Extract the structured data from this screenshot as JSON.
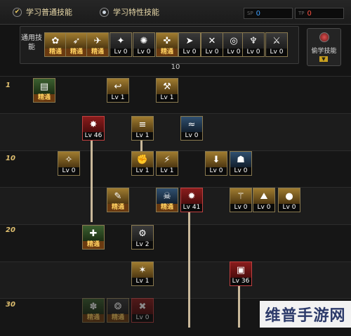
{
  "tabs": {
    "normal": {
      "label": "学习普通技能",
      "checkmark": "✔"
    },
    "special": {
      "label": "学习特性技能"
    }
  },
  "counters": [
    {
      "label": "SP",
      "value": "0",
      "color": "#3fa0ff"
    },
    {
      "label": "TP",
      "value": "0",
      "color": "#ff5040"
    }
  ],
  "common_skills": {
    "label": "通用技能",
    "slots": [
      {
        "icon": "lotus-meditation-icon",
        "lv": "精通",
        "gold": true,
        "glyph": "✿"
      },
      {
        "icon": "rising-strike-icon",
        "lv": "精通",
        "gold": true,
        "glyph": "➶"
      },
      {
        "icon": "leap-kick-icon",
        "lv": "精通",
        "gold": true,
        "glyph": "✈"
      },
      {
        "icon": "wing-icon",
        "lv": "Lv 0",
        "gold": false,
        "glyph": "✦"
      },
      {
        "icon": "sigil-icon",
        "lv": "Lv 0",
        "gold": false,
        "glyph": "✺"
      },
      {
        "icon": "crosshair-icon",
        "lv": "精通",
        "gold": true,
        "glyph": "✜"
      },
      {
        "icon": "dash-icon",
        "lv": "Lv 0",
        "gold": false,
        "glyph": "➤"
      },
      {
        "icon": "fallen-icon",
        "lv": "Lv 0",
        "gold": false,
        "glyph": "✕"
      },
      {
        "icon": "target-icon",
        "lv": "Lv 0",
        "gold": false,
        "glyph": "◎"
      },
      {
        "icon": "buff-icon",
        "lv": "Lv 0",
        "gold": false,
        "glyph": "♆"
      },
      {
        "icon": "guard-icon",
        "lv": "Lv 0",
        "gold": false,
        "glyph": "⚔"
      }
    ],
    "count": "10"
  },
  "secret_skills": {
    "label": "偷学技能",
    "arrow": "▼"
  },
  "level_markers": [
    "1",
    "10",
    "20",
    "30"
  ],
  "tree_skills": [
    {
      "icon": "book-icon",
      "lv": "精通",
      "gold": true,
      "tone": "green",
      "glyph": "▤"
    },
    {
      "icon": "grab-icon",
      "lv": "Lv 1",
      "gold": false,
      "tone": "gold",
      "glyph": "↩"
    },
    {
      "icon": "slash-icon",
      "lv": "Lv 1",
      "gold": false,
      "tone": "gold",
      "glyph": "⚒"
    },
    {
      "icon": "burst-icon",
      "lv": "Lv 46",
      "gold": false,
      "tone": "red",
      "glyph": "✸"
    },
    {
      "icon": "combo-icon",
      "lv": "Lv 1",
      "gold": false,
      "tone": "gold",
      "glyph": "≡"
    },
    {
      "icon": "wave-icon",
      "lv": "Lv 0",
      "gold": false,
      "tone": "blue",
      "glyph": "≈"
    },
    {
      "icon": "spin-icon",
      "lv": "Lv 0",
      "gold": false,
      "tone": "gold",
      "glyph": "✧"
    },
    {
      "icon": "uppercut-icon",
      "lv": "Lv 1",
      "gold": false,
      "tone": "gold",
      "glyph": "✊"
    },
    {
      "icon": "blade-icon",
      "lv": "Lv 1",
      "gold": false,
      "tone": "gold",
      "glyph": "⚡"
    },
    {
      "icon": "ground-slam-icon",
      "lv": "Lv 0",
      "gold": false,
      "tone": "gold",
      "glyph": "⬇"
    },
    {
      "icon": "mask-icon",
      "lv": "Lv 0",
      "gold": false,
      "tone": "blue",
      "glyph": "☗"
    },
    {
      "icon": "mastery-icon",
      "lv": "精通",
      "gold": true,
      "tone": "gold",
      "glyph": "✎"
    },
    {
      "icon": "demon-icon",
      "lv": "精通",
      "gold": true,
      "tone": "blue",
      "glyph": "☠"
    },
    {
      "icon": "rage-icon",
      "lv": "Lv 41",
      "gold": false,
      "tone": "red",
      "glyph": "✹"
    },
    {
      "icon": "axe-icon",
      "lv": "Lv 0",
      "gold": false,
      "tone": "gold",
      "glyph": "⚚"
    },
    {
      "icon": "quake-icon",
      "lv": "Lv 0",
      "gold": false,
      "tone": "gold",
      "glyph": "⛰"
    },
    {
      "icon": "orb-icon",
      "lv": "Lv 0",
      "gold": false,
      "tone": "gold",
      "glyph": "●"
    },
    {
      "icon": "fury-icon",
      "lv": "精通",
      "gold": true,
      "tone": "green",
      "glyph": "✚"
    },
    {
      "icon": "chain-icon",
      "lv": "Lv 2",
      "gold": false,
      "tone": "gray",
      "glyph": "⚙"
    },
    {
      "icon": "vortex-icon",
      "lv": "Lv 1",
      "gold": false,
      "tone": "gold",
      "glyph": "✶"
    },
    {
      "icon": "awaken-icon",
      "lv": "Lv 36",
      "gold": false,
      "tone": "red",
      "glyph": "▣"
    },
    {
      "icon": "spirit-icon",
      "lv": "精通",
      "gold": true,
      "tone": "green",
      "glyph": "✽",
      "faded": true
    },
    {
      "icon": "ghost-icon",
      "lv": "精通",
      "gold": true,
      "tone": "gray",
      "glyph": "❂",
      "faded": true
    },
    {
      "icon": "strike-icon",
      "lv": "Lv 0",
      "gold": false,
      "tone": "red",
      "glyph": "✖",
      "faded": true
    }
  ],
  "watermark": "维普手游网"
}
